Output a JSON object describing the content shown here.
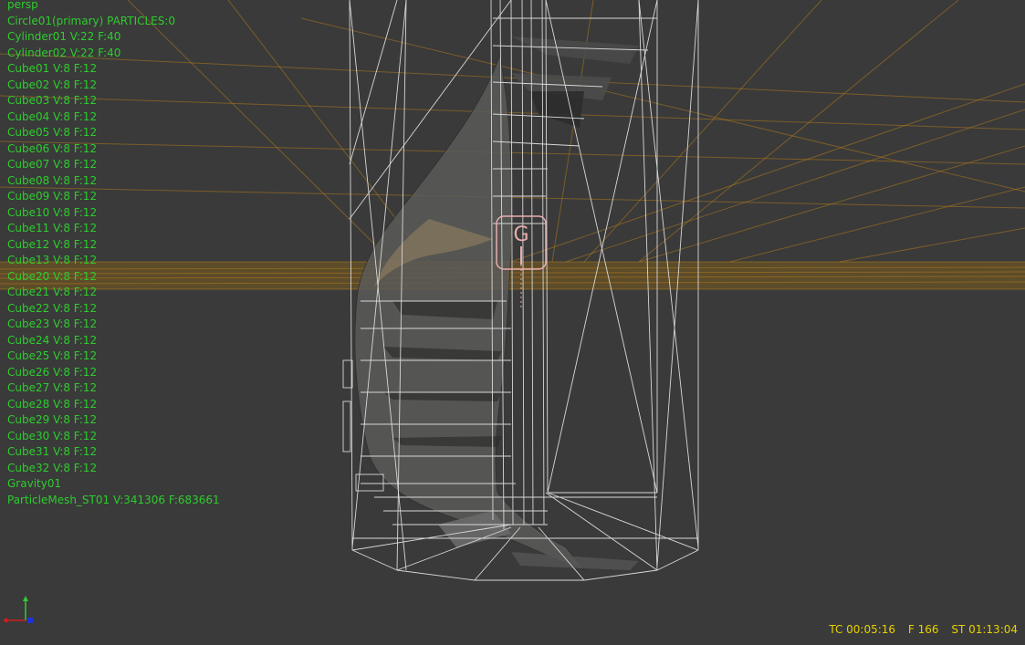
{
  "viewport": {
    "camera": "persp",
    "objects": [
      "Circle01(primary) PARTICLES:0",
      "Cylinder01 V:22 F:40",
      "Cylinder02 V:22 F:40",
      "Cube01 V:8 F:12",
      "Cube02 V:8 F:12",
      "Cube03 V:8 F:12",
      "Cube04 V:8 F:12",
      "Cube05 V:8 F:12",
      "Cube06 V:8 F:12",
      "Cube07 V:8 F:12",
      "Cube08 V:8 F:12",
      "Cube09 V:8 F:12",
      "Cube10 V:8 F:12",
      "Cube11 V:8 F:12",
      "Cube12 V:8 F:12",
      "Cube13 V:8 F:12",
      "Cube20 V:8 F:12",
      "Cube21 V:8 F:12",
      "Cube22 V:8 F:12",
      "Cube23 V:8 F:12",
      "Cube24 V:8 F:12",
      "Cube25 V:8 F:12",
      "Cube26 V:8 F:12",
      "Cube27 V:8 F:12",
      "Cube28 V:8 F:12",
      "Cube29 V:8 F:12",
      "Cube30 V:8 F:12",
      "Cube31 V:8 F:12",
      "Cube32 V:8 F:12",
      "Gravity01",
      "ParticleMesh_ST01 V:341306 F:683661"
    ],
    "gravity_gizmo_label": "G"
  },
  "status": {
    "timecode": "TC 00:05:16",
    "frame": "F 166",
    "sim_time": "ST 01:13:04"
  },
  "colors": {
    "background": "#3a3a3a",
    "list_text": "#2ecc2e",
    "status_text": "#e6d000",
    "wireframe": "#d8d8d8",
    "grid": "#b07a1c",
    "gizmo": "#e8aeb0"
  },
  "icons": {
    "axis": "axis-gizmo-icon"
  }
}
